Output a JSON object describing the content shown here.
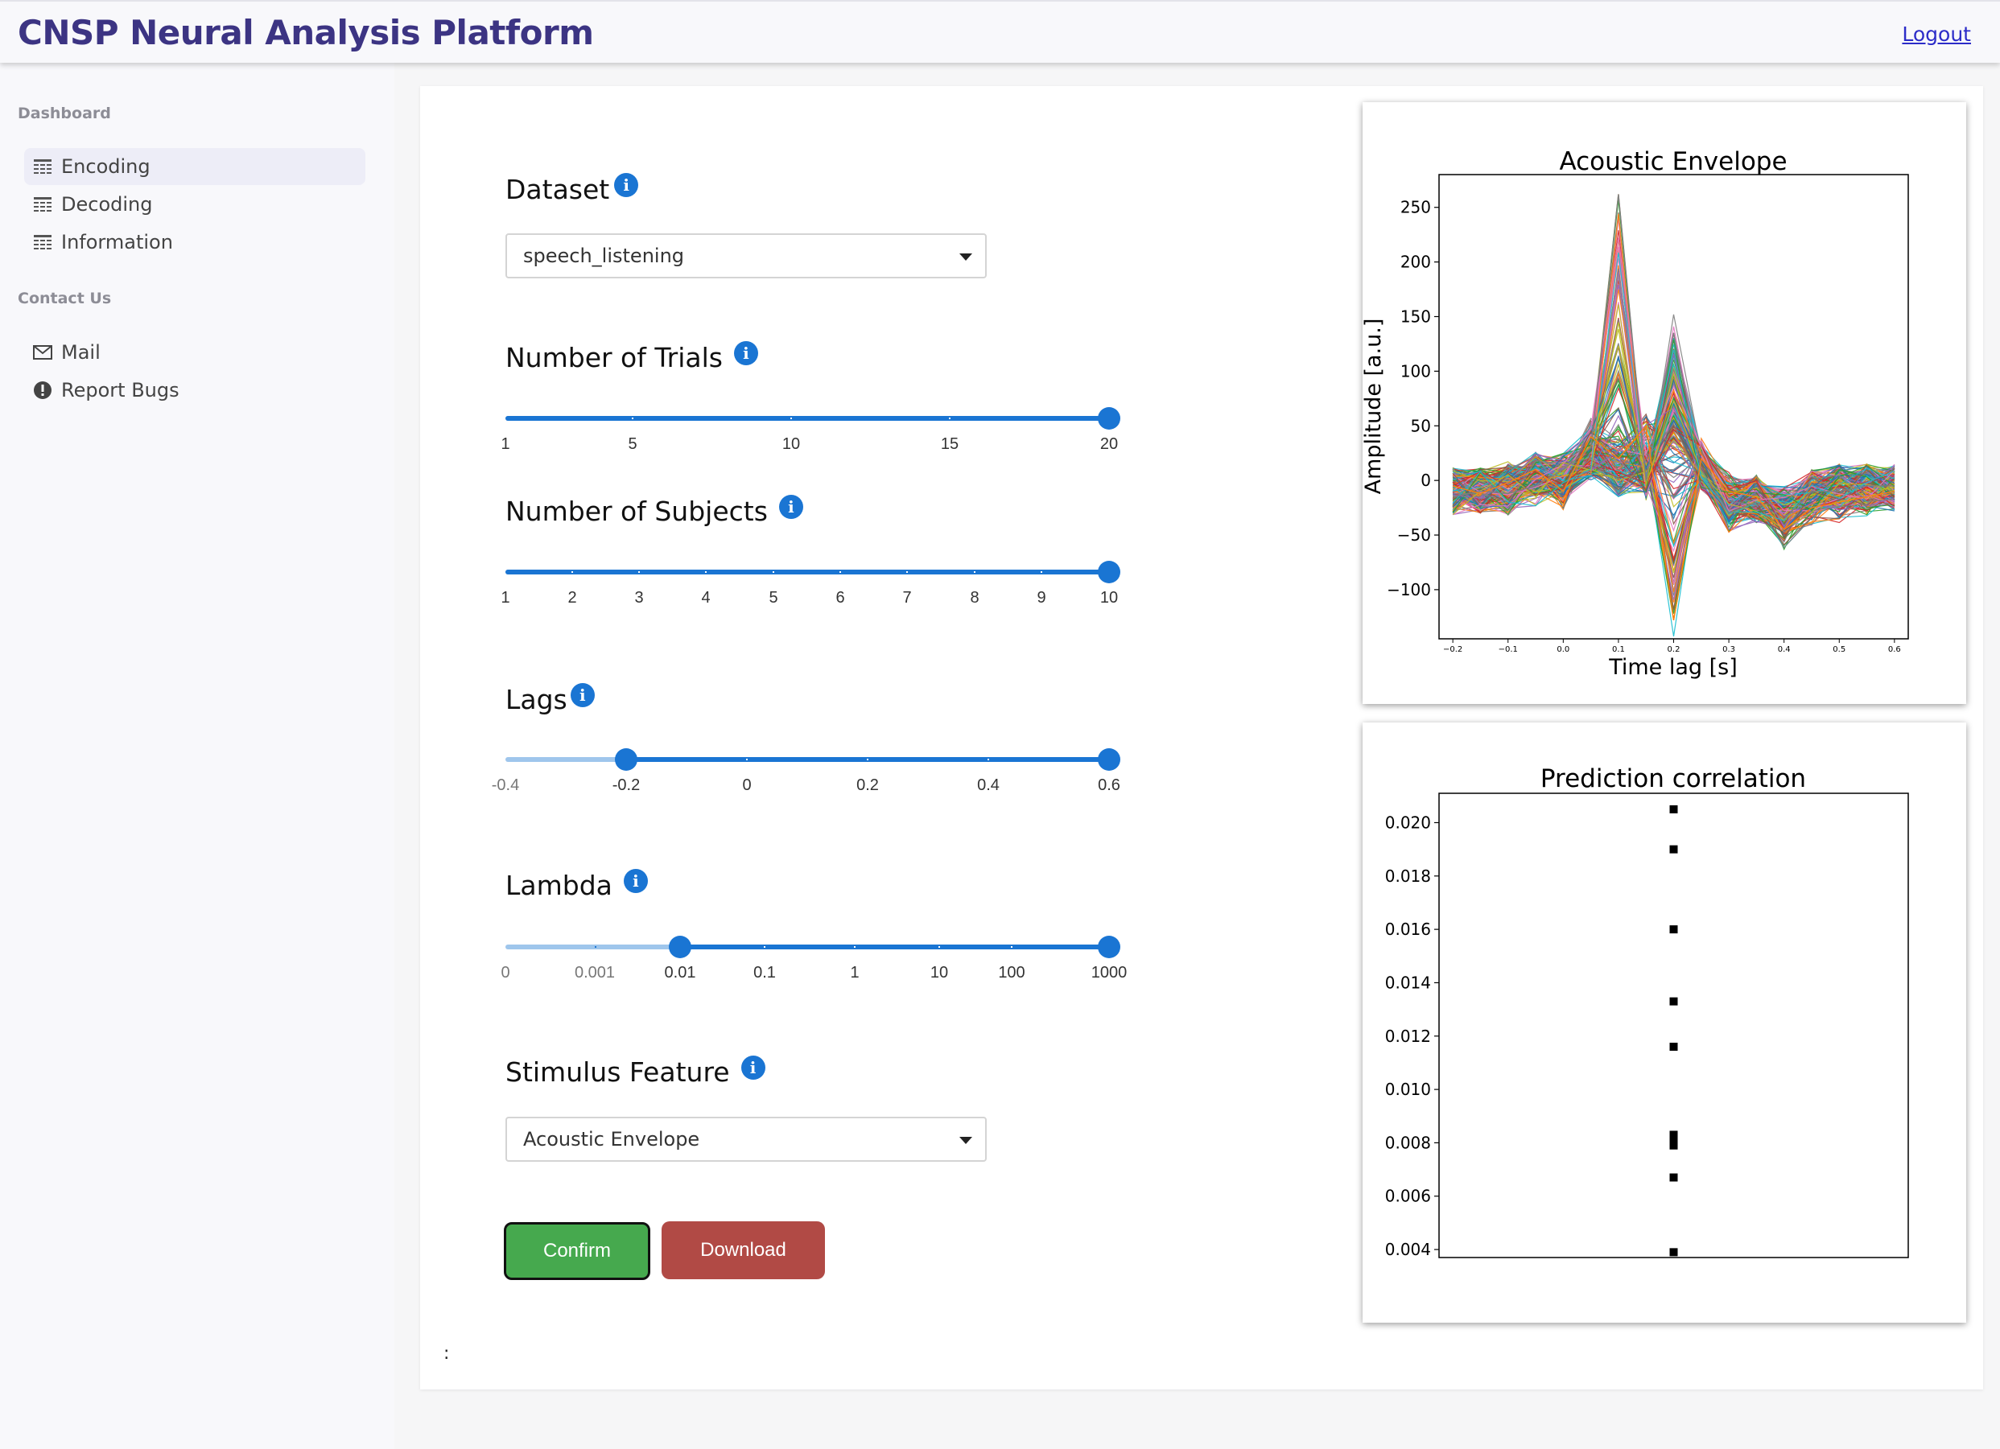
{
  "header": {
    "title": "CNSP Neural Analysis Platform",
    "logout": "Logout"
  },
  "sidebar": {
    "dashboard_heading": "Dashboard",
    "items": [
      {
        "label": "Encoding",
        "icon": "table-icon",
        "active": true
      },
      {
        "label": "Decoding",
        "icon": "table-icon",
        "active": false
      },
      {
        "label": "Information",
        "icon": "table-icon",
        "active": false
      }
    ],
    "contact_heading": "Contact Us",
    "contact_items": [
      {
        "label": "Mail",
        "icon": "mail-icon"
      },
      {
        "label": "Report Bugs",
        "icon": "alert-icon"
      }
    ]
  },
  "form": {
    "dataset": {
      "label": "Dataset",
      "value": "speech_listening"
    },
    "trials": {
      "label": "Number of Trials",
      "ticks": [
        "1",
        "5",
        "10",
        "15",
        "20"
      ],
      "value": 20,
      "min": 1,
      "max": 20
    },
    "subjects": {
      "label": "Number of Subjects",
      "ticks": [
        "1",
        "2",
        "3",
        "4",
        "5",
        "6",
        "7",
        "8",
        "9",
        "10"
      ],
      "value": 10,
      "min": 1,
      "max": 10
    },
    "lags": {
      "label": "Lags",
      "ticks": [
        "-0.4",
        "-0.2",
        "0",
        "0.2",
        "0.4",
        "0.6"
      ],
      "range": [
        -0.2,
        0.6
      ],
      "min": -0.4,
      "max": 0.6
    },
    "lambda": {
      "label": "Lambda",
      "ticks": [
        "0",
        "0.001",
        "0.01",
        "0.1",
        "1",
        "10",
        "100",
        "1000"
      ],
      "range": [
        "0.01",
        "1000"
      ]
    },
    "stimulus": {
      "label": "Stimulus Feature",
      "value": "Acoustic Envelope"
    },
    "confirm_label": "Confirm",
    "download_label": "Download",
    "footer_text": ":"
  },
  "chart_data": [
    {
      "type": "line",
      "title": "Acoustic Envelope",
      "xlabel": "Time lag [s]",
      "ylabel": "Amplitude [a.u.]",
      "x_ticks": [
        "−0.2",
        "−0.1",
        "0.0",
        "0.1",
        "0.2",
        "0.3",
        "0.4",
        "0.5",
        "0.6"
      ],
      "y_ticks": [
        "250",
        "200",
        "150",
        "100",
        "50",
        "0",
        "−50",
        "−100"
      ],
      "xlim": [
        -0.225,
        0.625
      ],
      "ylim": [
        -145,
        280
      ],
      "x": [
        -0.2,
        -0.15,
        -0.1,
        -0.05,
        0.0,
        0.05,
        0.1,
        0.15,
        0.2,
        0.25,
        0.3,
        0.35,
        0.4,
        0.45,
        0.5,
        0.55,
        0.6
      ],
      "mean_waveform": [
        -10,
        -8,
        -6,
        6,
        4,
        20,
        5,
        6,
        55,
        15,
        -20,
        -15,
        -25,
        -10,
        -5,
        -5,
        -5
      ],
      "peak_waveform": [
        -15,
        -10,
        -12,
        -5,
        10,
        30,
        262,
        0,
        135,
        10,
        -30,
        -20,
        -35,
        -10,
        -10,
        -5,
        -5
      ],
      "trough_waveform": [
        -5,
        -12,
        -2,
        10,
        -10,
        40,
        20,
        50,
        -128,
        20,
        -10,
        -15,
        -45,
        -25,
        -20,
        -15,
        -10
      ],
      "series_count": 200
    },
    {
      "type": "scatter",
      "title": "Prediction correlation",
      "xlabel": "",
      "ylabel": "",
      "y_ticks": [
        "0.020",
        "0.018",
        "0.016",
        "0.014",
        "0.012",
        "0.010",
        "0.008",
        "0.006",
        "0.004"
      ],
      "ylim": [
        0.0037,
        0.0211
      ],
      "x": 0,
      "values": [
        0.0205,
        0.019,
        0.016,
        0.0133,
        0.0116,
        0.0083,
        0.0081,
        0.0079,
        0.0067,
        0.0039
      ]
    }
  ]
}
